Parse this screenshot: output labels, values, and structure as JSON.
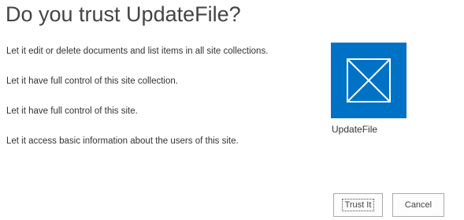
{
  "dialog": {
    "title": "Do you trust UpdateFile?",
    "permissions": [
      "Let it edit or delete documents and list items in all site collections.",
      "Let it have full control of this site collection.",
      "Let it have full control of this site.",
      "Let it access basic information about the users of this site."
    ],
    "app": {
      "name": "UpdateFile",
      "icon": "app-placeholder-icon",
      "tile_color": "#0072c6"
    },
    "buttons": {
      "trust_label": "Trust It",
      "cancel_label": "Cancel"
    }
  }
}
